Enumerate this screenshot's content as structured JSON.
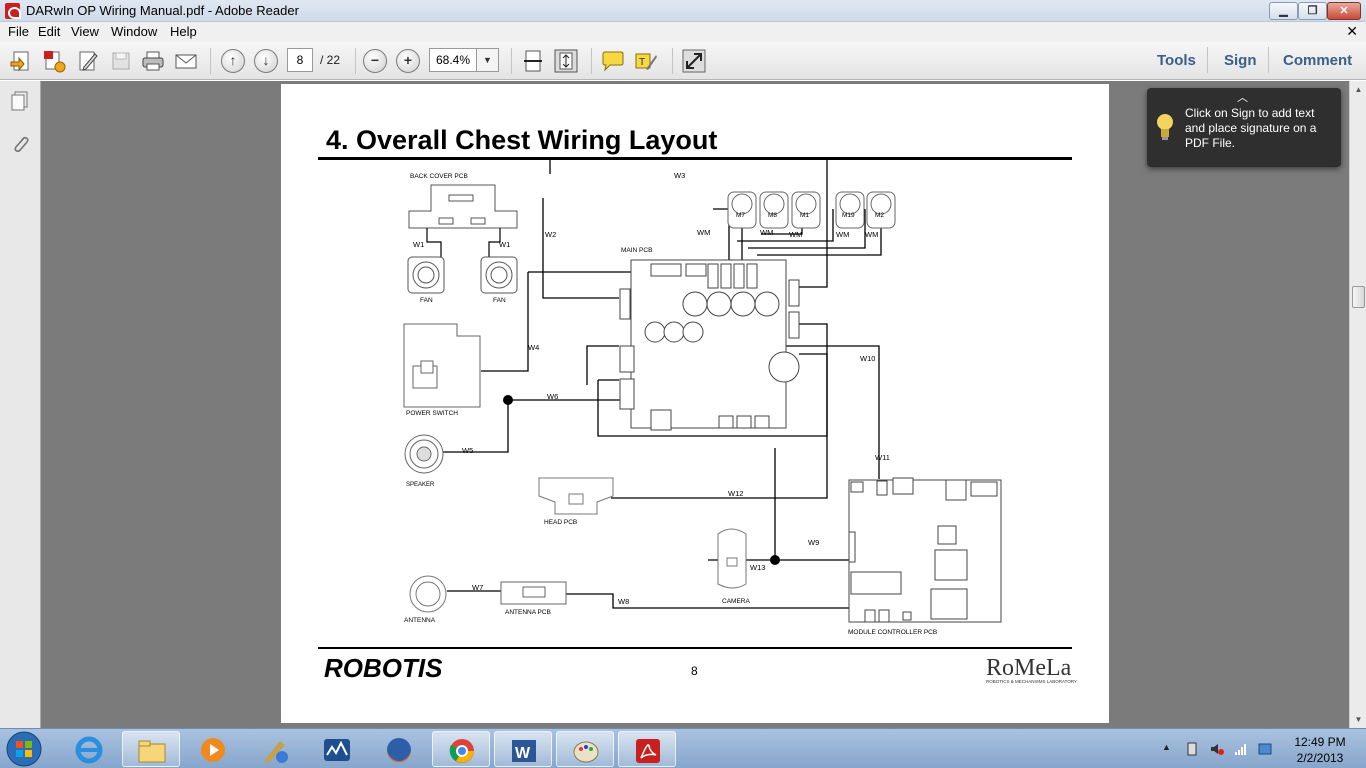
{
  "window": {
    "title": "DARwIn OP Wiring Manual.pdf - Adobe Reader"
  },
  "menu": {
    "items": [
      "File",
      "Edit",
      "View",
      "Window",
      "Help"
    ]
  },
  "toolbar": {
    "page_current": "8",
    "page_total": "/ 22",
    "zoom": "68.4%",
    "tools_label": "Tools",
    "sign_label": "Sign",
    "comment_label": "Comment"
  },
  "tooltip": {
    "text": "Click on Sign to add text and place signature on a PDF File."
  },
  "document": {
    "heading": "4. Overall Chest Wiring Layout",
    "page_number": "8",
    "footer_left_logo": "ROBOTIS",
    "footer_right_logo": "RoMeLa",
    "footer_right_sub": "ROBOTICS & MECHANISMS LABORATORY",
    "labels": {
      "back_cover_pcb": "BACK COVER PCB",
      "main_pcb": "MAIN PCB",
      "fan": "FAN",
      "power_switch": "POWER SWITCH",
      "speaker": "SPEAKER",
      "head_pcb": "HEAD PCB",
      "antenna": "ANTENNA",
      "antenna_pcb": "ANTENNA PCB",
      "camera": "CAMERA",
      "module_controller_pcb": "MODULE CONTROLLER PCB",
      "w1": "W1",
      "w2": "W2",
      "w3": "W3",
      "w4": "W4",
      "w5": "W5",
      "w6": "W6",
      "w7": "W7",
      "w8": "W8",
      "w9": "W9",
      "w10": "W10",
      "w11": "W11",
      "w12": "W12",
      "w13": "W13",
      "wm": "WM",
      "m7": "M7",
      "m8": "M8",
      "m1": "M1",
      "m19": "M19",
      "m2": "M2"
    }
  },
  "taskbar": {
    "time": "12:49 PM",
    "date": "2/2/2013",
    "apps": [
      "Internet Explorer",
      "Windows Explorer",
      "Windows Media Player",
      "Paint Tool",
      "4G WiMAX",
      "Firefox",
      "Chrome",
      "Microsoft Word",
      "Paint",
      "Adobe Reader"
    ]
  },
  "colors": {
    "accent_link": "#3b5f88",
    "doc_background": "#7b7b7b",
    "tooltip_bg": "#2f2f2f"
  }
}
